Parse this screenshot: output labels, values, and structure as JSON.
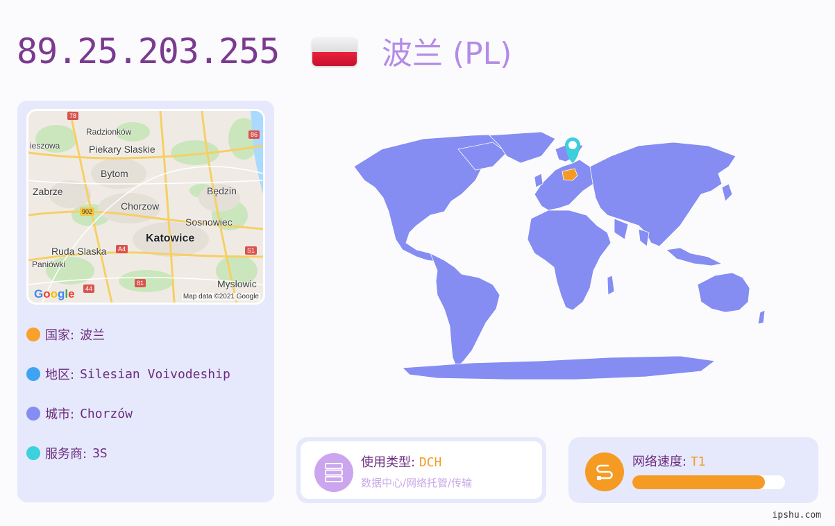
{
  "header": {
    "ip": "89.25.203.255",
    "country_title": "波兰 (PL)"
  },
  "map": {
    "labels": [
      "Radzionków",
      "ieszowa",
      "Piekary Slaskie",
      "Bytom",
      "Zabrze",
      "Będzin",
      "Chorzow",
      "Sosnowiec",
      "Katowice",
      "Ruda Slaska",
      "Paniówki",
      "Myslowic"
    ],
    "road_badges": [
      "78",
      "86",
      "902",
      "A4",
      "S1",
      "44",
      "81"
    ],
    "google_logo": "Google",
    "credit": "Map data ©2021 Google"
  },
  "info": {
    "country_label": "国家:",
    "country_value": "波兰",
    "region_label": "地区:",
    "region_value": "Silesian Voivodeship",
    "city_label": "城市:",
    "city_value": "Chorzów",
    "isp_label": "服务商:",
    "isp_value": "3S"
  },
  "usage": {
    "label": "使用类型:",
    "value": "DCH",
    "description": "数据中心/网络托管/传输"
  },
  "speed": {
    "label": "网络速度:",
    "value": "T1",
    "progress_fraction": 0.87
  },
  "footer": {
    "site": "ipshu.com"
  },
  "colors": {
    "ip_text": "#7b3a8f",
    "country_text": "#b48be6",
    "dot_country": "#f9a12b",
    "dot_region": "#3fa3f3",
    "dot_city": "#858df2",
    "dot_isp": "#3dd0dd",
    "world_land": "#858df2",
    "highlight_country": "#f59b23",
    "pin": "#3dcfdc",
    "accent_orange": "#f59b23"
  },
  "icons": {
    "usage_icon": "server-icon",
    "speed_icon": "speed-cable-icon",
    "pin_icon": "location-pin-icon"
  }
}
